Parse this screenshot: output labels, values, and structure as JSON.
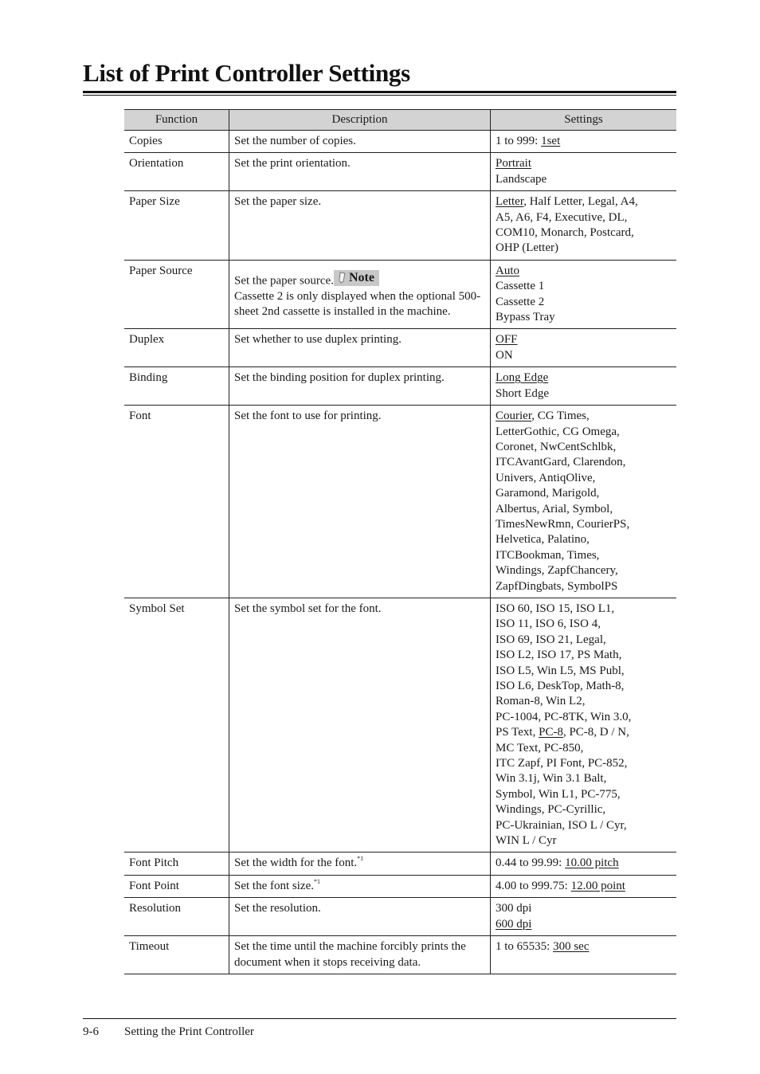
{
  "page": {
    "title": "List of Print Controller Settings",
    "footer": {
      "page_number": "9-6",
      "section": "Setting the Print Controller"
    }
  },
  "table": {
    "headers": [
      "Function",
      "Description",
      "Settings"
    ],
    "rows": [
      {
        "function": "Copies",
        "description": "Set the number of copies.",
        "settings": [
          {
            "segments": [
              {
                "text": "1 to 999: ",
                "default": false
              },
              {
                "text": "1set",
                "default": true
              }
            ]
          }
        ]
      },
      {
        "function": "Orientation",
        "description": "Set the print orientation.",
        "settings": [
          {
            "segments": [
              {
                "text": "Portrait",
                "default": true
              }
            ]
          },
          {
            "segments": [
              {
                "text": "Landscape",
                "default": false
              }
            ]
          }
        ]
      },
      {
        "function": "Paper Size",
        "description": "Set the paper size.",
        "settings": [
          {
            "segments": [
              {
                "text": "Letter",
                "default": true
              },
              {
                "text": ", Half Letter, Legal, A4,",
                "default": false
              }
            ]
          },
          {
            "segments": [
              {
                "text": "A5, A6, F4, Executive, DL,",
                "default": false
              }
            ]
          },
          {
            "segments": [
              {
                "text": "COM10, Monarch, Postcard,",
                "default": false
              }
            ]
          },
          {
            "segments": [
              {
                "text": "OHP (Letter)",
                "default": false
              }
            ]
          }
        ]
      },
      {
        "function": "Paper Source",
        "description": "Set the paper source.",
        "note": {
          "label": "Note",
          "icon": "pencil-icon",
          "text": "Cassette 2 is only displayed when the optional 500-sheet 2nd cassette is installed in the machine."
        },
        "settings": [
          {
            "segments": [
              {
                "text": "Auto",
                "default": true
              }
            ]
          },
          {
            "segments": [
              {
                "text": "Cassette 1",
                "default": false
              }
            ]
          },
          {
            "segments": [
              {
                "text": "Cassette 2",
                "default": false
              }
            ]
          },
          {
            "segments": [
              {
                "text": "Bypass Tray",
                "default": false
              }
            ]
          }
        ]
      },
      {
        "function": "Duplex",
        "description": "Set whether to use duplex printing.",
        "settings": [
          {
            "segments": [
              {
                "text": "OFF",
                "default": true
              }
            ]
          },
          {
            "segments": [
              {
                "text": "ON",
                "default": false
              }
            ]
          }
        ]
      },
      {
        "function": "Binding",
        "description": "Set the binding position for duplex printing.",
        "settings": [
          {
            "segments": [
              {
                "text": "Long Edge",
                "default": true
              }
            ]
          },
          {
            "segments": [
              {
                "text": "Short Edge",
                "default": false
              }
            ]
          }
        ]
      },
      {
        "function": "Font",
        "description": "Set the font to use for printing.",
        "settings": [
          {
            "segments": [
              {
                "text": "Courier",
                "default": true
              },
              {
                "text": ", CG Times,",
                "default": false
              }
            ]
          },
          {
            "segments": [
              {
                "text": "LetterGothic, CG Omega,",
                "default": false
              }
            ]
          },
          {
            "segments": [
              {
                "text": "Coronet, NwCentSchlbk,",
                "default": false
              }
            ]
          },
          {
            "segments": [
              {
                "text": "ITCAvantGard, Clarendon,",
                "default": false
              }
            ]
          },
          {
            "segments": [
              {
                "text": "Univers, AntiqOlive,",
                "default": false
              }
            ]
          },
          {
            "segments": [
              {
                "text": "Garamond, Marigold,",
                "default": false
              }
            ]
          },
          {
            "segments": [
              {
                "text": "Albertus, Arial, Symbol,",
                "default": false
              }
            ]
          },
          {
            "segments": [
              {
                "text": "TimesNewRmn, CourierPS,",
                "default": false
              }
            ]
          },
          {
            "segments": [
              {
                "text": "Helvetica, Palatino,",
                "default": false
              }
            ]
          },
          {
            "segments": [
              {
                "text": "ITCBookman, Times,",
                "default": false
              }
            ]
          },
          {
            "segments": [
              {
                "text": "Windings, ZapfChancery,",
                "default": false
              }
            ]
          },
          {
            "segments": [
              {
                "text": "ZapfDingbats, SymbolPS",
                "default": false
              }
            ]
          }
        ]
      },
      {
        "function": "Symbol Set",
        "description": "Set the symbol set for the font.",
        "settings": [
          {
            "segments": [
              {
                "text": "ISO 60, ISO 15, ISO L1,",
                "default": false
              }
            ]
          },
          {
            "segments": [
              {
                "text": "ISO 11, ISO 6, ISO 4,",
                "default": false
              }
            ]
          },
          {
            "segments": [
              {
                "text": "ISO 69, ISO 21, Legal,",
                "default": false
              }
            ]
          },
          {
            "segments": [
              {
                "text": "ISO L2, ISO 17, PS Math,",
                "default": false
              }
            ]
          },
          {
            "segments": [
              {
                "text": "ISO L5, Win L5, MS Publ,",
                "default": false
              }
            ]
          },
          {
            "segments": [
              {
                "text": "ISO L6, DeskTop, Math-8,",
                "default": false
              }
            ]
          },
          {
            "segments": [
              {
                "text": "Roman-8, Win L2,",
                "default": false
              }
            ]
          },
          {
            "segments": [
              {
                "text": "PC-1004, PC-8TK, Win 3.0,",
                "default": false
              }
            ]
          },
          {
            "segments": [
              {
                "text": "PS Text, ",
                "default": false
              },
              {
                "text": "PC-8",
                "default": true
              },
              {
                "text": ", PC-8, D / N,",
                "default": false
              }
            ]
          },
          {
            "segments": [
              {
                "text": "MC Text, PC-850,",
                "default": false
              }
            ]
          },
          {
            "segments": [
              {
                "text": "ITC Zapf, PI Font, PC-852,",
                "default": false
              }
            ]
          },
          {
            "segments": [
              {
                "text": "Win 3.1j, Win 3.1 Balt,",
                "default": false
              }
            ]
          },
          {
            "segments": [
              {
                "text": "Symbol, Win L1, PC-775,",
                "default": false
              }
            ]
          },
          {
            "segments": [
              {
                "text": "Windings, PC-Cyrillic,",
                "default": false
              }
            ]
          },
          {
            "segments": [
              {
                "text": "PC-Ukrainian, ISO L / Cyr,",
                "default": false
              }
            ]
          },
          {
            "segments": [
              {
                "text": "WIN L / Cyr",
                "default": false
              }
            ]
          }
        ]
      },
      {
        "function": "Font Pitch",
        "description": "Set the width for the font.",
        "footnote": "*1",
        "settings": [
          {
            "segments": [
              {
                "text": "0.44 to 99.99: ",
                "default": false
              },
              {
                "text": "10.00 pitch",
                "default": true
              }
            ]
          }
        ]
      },
      {
        "function": "Font Point",
        "description": "Set the font size.",
        "footnote": "*1",
        "settings": [
          {
            "segments": [
              {
                "text": "4.00 to 999.75: ",
                "default": false
              },
              {
                "text": "12.00 point",
                "default": true
              }
            ]
          }
        ]
      },
      {
        "function": "Resolution",
        "description": "Set the resolution.",
        "settings": [
          {
            "segments": [
              {
                "text": "300 dpi",
                "default": false
              }
            ]
          },
          {
            "segments": [
              {
                "text": "600 dpi",
                "default": true
              }
            ]
          }
        ]
      },
      {
        "function": "Timeout",
        "description": "Set the time until the machine forcibly prints the document when it stops receiving data.",
        "settings": [
          {
            "segments": [
              {
                "text": "1 to 65535: ",
                "default": false
              },
              {
                "text": "300 sec",
                "default": true
              }
            ]
          }
        ]
      }
    ]
  }
}
